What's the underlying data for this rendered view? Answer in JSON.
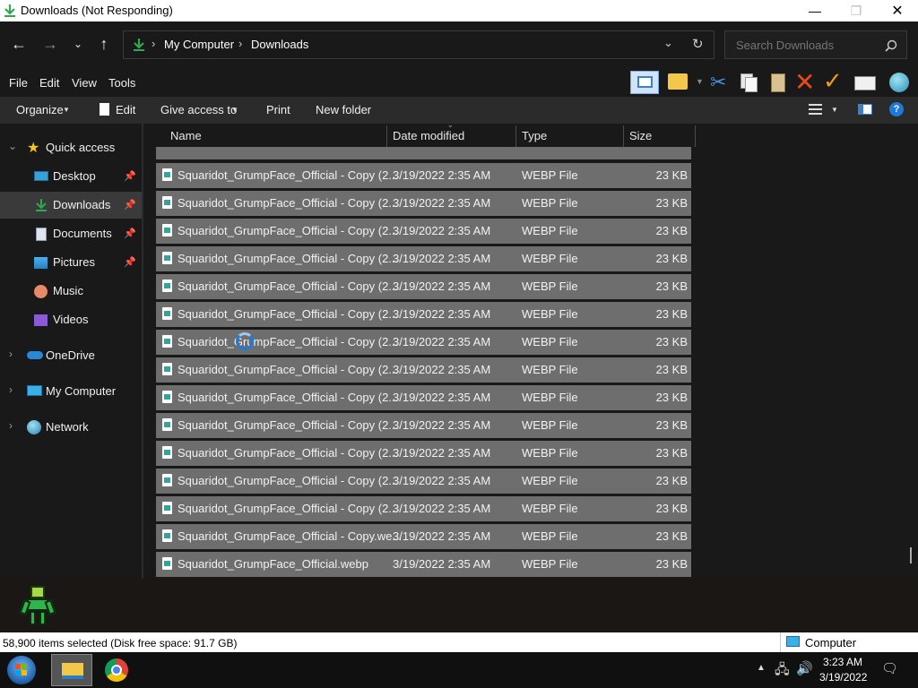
{
  "window": {
    "title": "Downloads (Not Responding)"
  },
  "address": {
    "crumbs": [
      "My Computer",
      "Downloads"
    ]
  },
  "search": {
    "placeholder": "Search Downloads"
  },
  "menu": {
    "file": "File",
    "edit": "Edit",
    "view": "View",
    "tools": "Tools"
  },
  "command": {
    "organize": "Organize",
    "edit": "Edit",
    "give_access": "Give access to",
    "print": "Print",
    "new_folder": "New folder"
  },
  "nav": {
    "quick_access": "Quick access",
    "desktop": "Desktop",
    "downloads": "Downloads",
    "documents": "Documents",
    "pictures": "Pictures",
    "music": "Music",
    "videos": "Videos",
    "onedrive": "OneDrive",
    "my_computer": "My Computer",
    "network": "Network"
  },
  "columns": {
    "name": "Name",
    "date": "Date modified",
    "type": "Type",
    "size": "Size"
  },
  "files": [
    {
      "name": "Squaridot_GrumpFace_Official - Copy (2...",
      "date": "3/19/2022 2:35 AM",
      "type": "WEBP File",
      "size": "23 KB"
    },
    {
      "name": "Squaridot_GrumpFace_Official - Copy (2...",
      "date": "3/19/2022 2:35 AM",
      "type": "WEBP File",
      "size": "23 KB"
    },
    {
      "name": "Squaridot_GrumpFace_Official - Copy (2...",
      "date": "3/19/2022 2:35 AM",
      "type": "WEBP File",
      "size": "23 KB"
    },
    {
      "name": "Squaridot_GrumpFace_Official - Copy (2...",
      "date": "3/19/2022 2:35 AM",
      "type": "WEBP File",
      "size": "23 KB"
    },
    {
      "name": "Squaridot_GrumpFace_Official - Copy (2...",
      "date": "3/19/2022 2:35 AM",
      "type": "WEBP File",
      "size": "23 KB"
    },
    {
      "name": "Squaridot_GrumpFace_Official - Copy (2...",
      "date": "3/19/2022 2:35 AM",
      "type": "WEBP File",
      "size": "23 KB"
    },
    {
      "name": "Squaridot_GrumpFace_Official - Copy (2...",
      "date": "3/19/2022 2:35 AM",
      "type": "WEBP File",
      "size": "23 KB"
    },
    {
      "name": "Squaridot_GrumpFace_Official - Copy (2...",
      "date": "3/19/2022 2:35 AM",
      "type": "WEBP File",
      "size": "23 KB"
    },
    {
      "name": "Squaridot_GrumpFace_Official - Copy (2...",
      "date": "3/19/2022 2:35 AM",
      "type": "WEBP File",
      "size": "23 KB"
    },
    {
      "name": "Squaridot_GrumpFace_Official - Copy (2...",
      "date": "3/19/2022 2:35 AM",
      "type": "WEBP File",
      "size": "23 KB"
    },
    {
      "name": "Squaridot_GrumpFace_Official - Copy (2...",
      "date": "3/19/2022 2:35 AM",
      "type": "WEBP File",
      "size": "23 KB"
    },
    {
      "name": "Squaridot_GrumpFace_Official - Copy (2...",
      "date": "3/19/2022 2:35 AM",
      "type": "WEBP File",
      "size": "23 KB"
    },
    {
      "name": "Squaridot_GrumpFace_Official - Copy (2...",
      "date": "3/19/2022 2:35 AM",
      "type": "WEBP File",
      "size": "23 KB"
    },
    {
      "name": "Squaridot_GrumpFace_Official - Copy (2...",
      "date": "3/19/2022 2:35 AM",
      "type": "WEBP File",
      "size": "23 KB"
    },
    {
      "name": "Squaridot_GrumpFace_Official - Copy.we...",
      "date": "3/19/2022 2:35 AM",
      "type": "WEBP File",
      "size": "23 KB"
    },
    {
      "name": "Squaridot_GrumpFace_Official.webp",
      "date": "3/19/2022 2:35 AM",
      "type": "WEBP File",
      "size": "23 KB"
    }
  ],
  "status": {
    "selection": "58,900 items selected (Disk free space: 91.7 GB)",
    "zone": "Computer"
  },
  "taskbar": {
    "time": "3:23 AM",
    "date": "3/19/2022"
  },
  "colors": {
    "selected_row": "#6e6e6e",
    "accent": "#0078d7",
    "folder_green": "#3cb043"
  }
}
